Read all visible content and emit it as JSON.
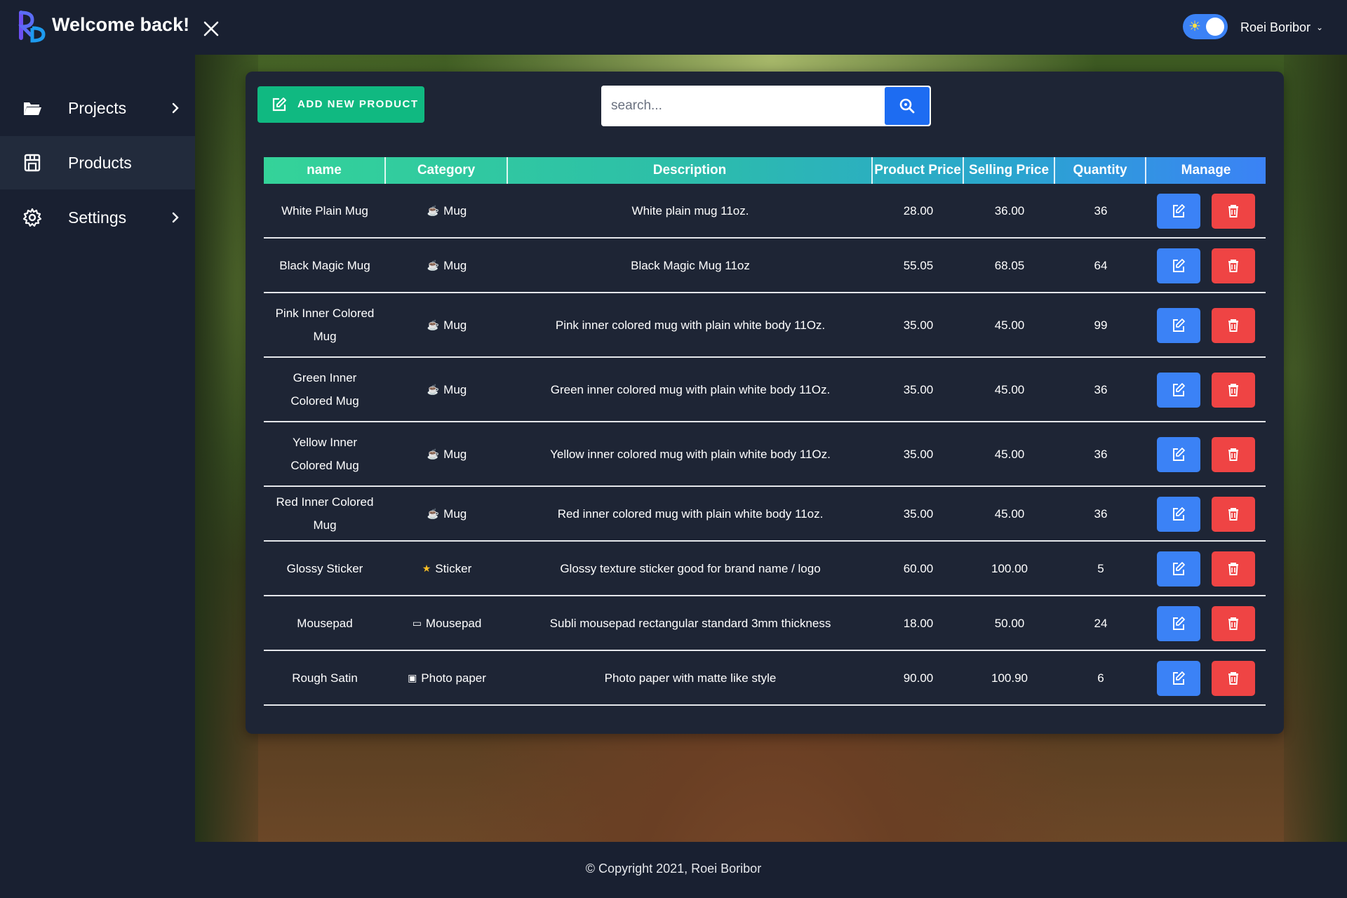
{
  "header": {
    "welcome": "Welcome back!",
    "user_name": "Roei Boribor",
    "accent": "#3b82f6"
  },
  "sidebar": {
    "items": [
      {
        "label": "Projects",
        "icon": "folder-icon"
      },
      {
        "label": "Products",
        "icon": "store-icon"
      },
      {
        "label": "Settings",
        "icon": "gear-icon"
      }
    ]
  },
  "toolbar": {
    "add_label": "ADD NEW PRODUCT",
    "search_placeholder": "search..."
  },
  "table": {
    "columns": [
      "name",
      "Category",
      "Description",
      "Product Price",
      "Selling Price",
      "Quantity",
      "Manage"
    ],
    "rows": [
      {
        "name": "White Plain Mug",
        "category_icon": "☕",
        "category": "Mug",
        "description": "White plain mug 11oz.",
        "product_price": "28.00",
        "selling_price": "36.00",
        "quantity": "36"
      },
      {
        "name": "Black Magic Mug",
        "category_icon": "☕",
        "category": "Mug",
        "description": "Black Magic Mug 11oz",
        "product_price": "55.05",
        "selling_price": "68.05",
        "quantity": "64"
      },
      {
        "name": "Pink Inner Colored Mug",
        "category_icon": "☕",
        "category": "Mug",
        "description": "Pink inner colored mug with plain white body 11Oz.",
        "product_price": "35.00",
        "selling_price": "45.00",
        "quantity": "99"
      },
      {
        "name": "Green Inner Colored Mug",
        "category_icon": "☕",
        "category": "Mug",
        "description": "Green inner colored mug with plain white body 11Oz.",
        "product_price": "35.00",
        "selling_price": "45.00",
        "quantity": "36"
      },
      {
        "name": "Yellow Inner Colored Mug",
        "category_icon": "☕",
        "category": "Mug",
        "description": "Yellow inner colored mug with plain white body 11Oz.",
        "product_price": "35.00",
        "selling_price": "45.00",
        "quantity": "36"
      },
      {
        "name": "Red Inner Colored Mug",
        "category_icon": "☕",
        "category": "Mug",
        "description": "Red inner colored mug with plain white body 11oz.",
        "product_price": "35.00",
        "selling_price": "45.00",
        "quantity": "36"
      },
      {
        "name": "Glossy Sticker",
        "category_icon": "★",
        "category": "Sticker",
        "description": "Glossy texture sticker good for brand name / logo",
        "product_price": "60.00",
        "selling_price": "100.00",
        "quantity": "5"
      },
      {
        "name": "Mousepad",
        "category_icon": "▭",
        "category": "Mousepad",
        "description": "Subli mousepad rectangular standard 3mm thickness",
        "product_price": "18.00",
        "selling_price": "50.00",
        "quantity": "24"
      },
      {
        "name": "Rough Satin",
        "category_icon": "▣",
        "category": "Photo paper",
        "description": "Photo paper with matte like style",
        "product_price": "90.00",
        "selling_price": "100.90",
        "quantity": "6"
      }
    ]
  },
  "footer": {
    "copyright": "© Copyright 2021, Roei Boribor"
  }
}
